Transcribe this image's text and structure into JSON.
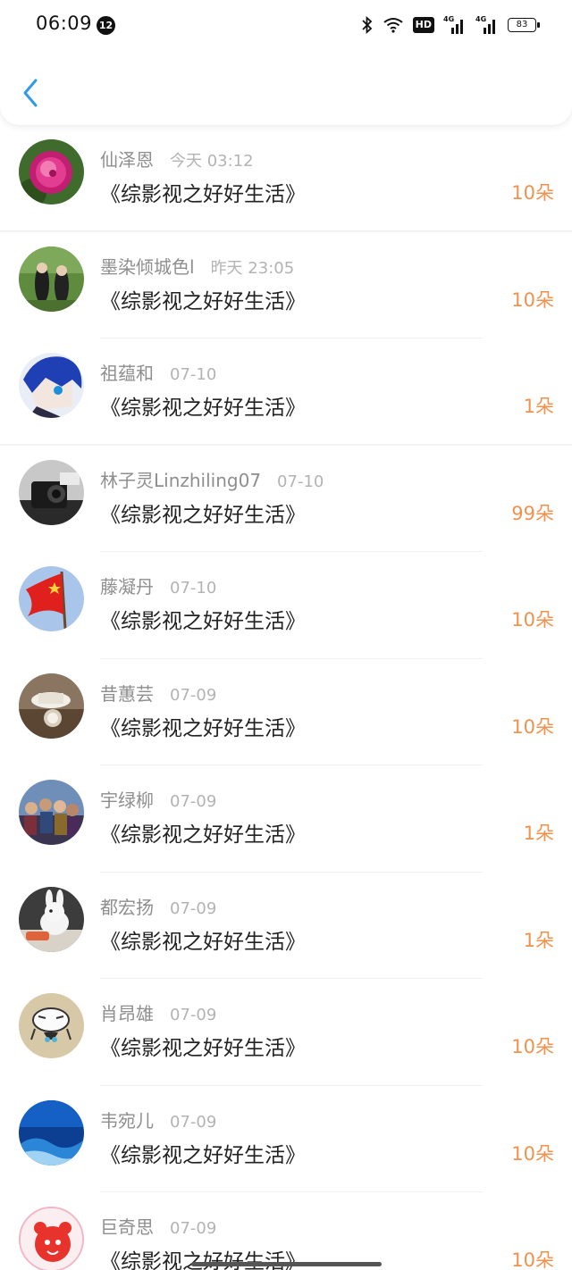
{
  "status_bar": {
    "time": "06:09",
    "notification_count": "12",
    "network_1": "4G",
    "network_2": "4G",
    "hd_label": "HD",
    "battery": "83"
  },
  "colors": {
    "accent_back": "#2f9be8",
    "count_orange": "#f0924e",
    "name_gray": "#8e8e8e",
    "date_gray": "#b3b3b3"
  },
  "list": [
    {
      "name": "仙泽恩",
      "date": "今天 03:12",
      "book": "《综影视之好好生活》",
      "flowers": "10朵",
      "avatar": "peony-flower"
    },
    {
      "name": "墨染倾城色l",
      "date": "昨天 23:05",
      "book": "《综影视之好好生活》",
      "flowers": "10朵",
      "avatar": "two-figures-green"
    },
    {
      "name": "祖蕴和",
      "date": "07-10",
      "book": "《综影视之好好生活》",
      "flowers": "1朵",
      "avatar": "anime-blue-hair"
    },
    {
      "name": "林子灵Linzhiling07",
      "date": "07-10",
      "book": "《综影视之好好生活》",
      "flowers": "99朵",
      "avatar": "camera-dark"
    },
    {
      "name": "藤凝丹",
      "date": "07-10",
      "book": "《综影视之好好生活》",
      "flowers": "10朵",
      "avatar": "red-flag"
    },
    {
      "name": "昔蕙芸",
      "date": "07-09",
      "book": "《综影视之好好生活》",
      "flowers": "10朵",
      "avatar": "teacup-clock"
    },
    {
      "name": "宇绿柳",
      "date": "07-09",
      "book": "《综影视之好好生活》",
      "flowers": "1朵",
      "avatar": "crowd-group"
    },
    {
      "name": "都宏扬",
      "date": "07-09",
      "book": "《综影视之好好生活》",
      "flowers": "1朵",
      "avatar": "white-rabbit"
    },
    {
      "name": "肖昂雄",
      "date": "07-09",
      "book": "《综影视之好好生活》",
      "flowers": "10朵",
      "avatar": "cartoon-face"
    },
    {
      "name": "韦宛儿",
      "date": "07-09",
      "book": "《综影视之好好生活》",
      "flowers": "10朵",
      "avatar": "blue-ocean"
    },
    {
      "name": "巨奇思",
      "date": "07-09",
      "book": "《综影视之好好生活》",
      "flowers": "10朵",
      "avatar": "red-cartoon"
    }
  ]
}
